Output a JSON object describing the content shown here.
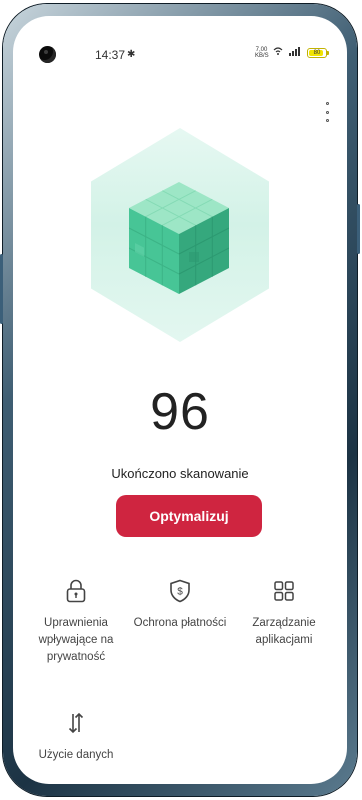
{
  "status_bar": {
    "time": "14:37",
    "bluetooth_icon": "bluetooth-icon",
    "net_speed_value": "7,00",
    "net_speed_unit": "KB/S",
    "wifi_icon": "wifi-icon",
    "signal_icon": "signal-icon",
    "battery_level": "80"
  },
  "header": {
    "more_icon": "more-vertical-icon"
  },
  "scan": {
    "score": "96",
    "status_text": "Ukończono skanowanie",
    "optimize_label": "Optymalizuj",
    "accent_color": "#cf2540"
  },
  "features": [
    {
      "label": "Uprawnienia wpływające na prywatność",
      "icon": "lock-icon"
    },
    {
      "label": "Ochrona płatności",
      "icon": "shield-dollar-icon"
    },
    {
      "label": "Zarządzanie aplikacjami",
      "icon": "grid-icon"
    },
    {
      "label": "Użycie danych",
      "icon": "data-transfer-icon"
    }
  ]
}
